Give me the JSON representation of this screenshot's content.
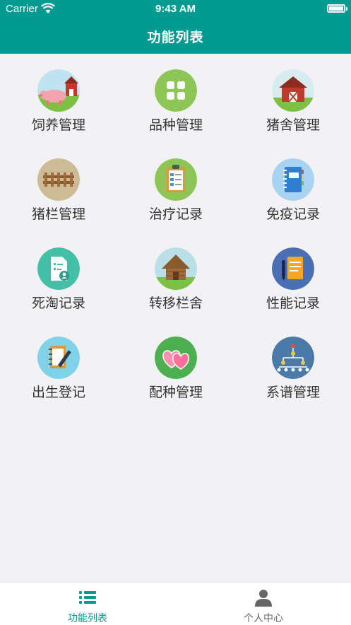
{
  "status_bar": {
    "carrier": "Carrier",
    "time": "9:43 AM"
  },
  "header": {
    "title": "功能列表"
  },
  "modules": [
    {
      "label": "饲养管理",
      "icon": "pig-farm-icon"
    },
    {
      "label": "品种管理",
      "icon": "grid-icon"
    },
    {
      "label": "猪舍管理",
      "icon": "barn-icon"
    },
    {
      "label": "猪栏管理",
      "icon": "fence-icon"
    },
    {
      "label": "治疗记录",
      "icon": "clipboard-icon"
    },
    {
      "label": "免疫记录",
      "icon": "notebook-icon"
    },
    {
      "label": "死淘记录",
      "icon": "document-user-icon"
    },
    {
      "label": "转移栏舍",
      "icon": "hut-icon"
    },
    {
      "label": "性能记录",
      "icon": "notepad-pen-icon"
    },
    {
      "label": "出生登记",
      "icon": "pencil-notebook-icon"
    },
    {
      "label": "配种管理",
      "icon": "hearts-icon"
    },
    {
      "label": "系谱管理",
      "icon": "pedigree-tree-icon"
    }
  ],
  "tab_bar": {
    "tabs": [
      {
        "label": "功能列表",
        "icon": "list-icon",
        "active": true
      },
      {
        "label": "个人中心",
        "icon": "person-icon",
        "active": false
      }
    ]
  },
  "colors": {
    "primary": "#009b91",
    "background": "#f2f2f4",
    "inactive_tab": "#666666"
  }
}
